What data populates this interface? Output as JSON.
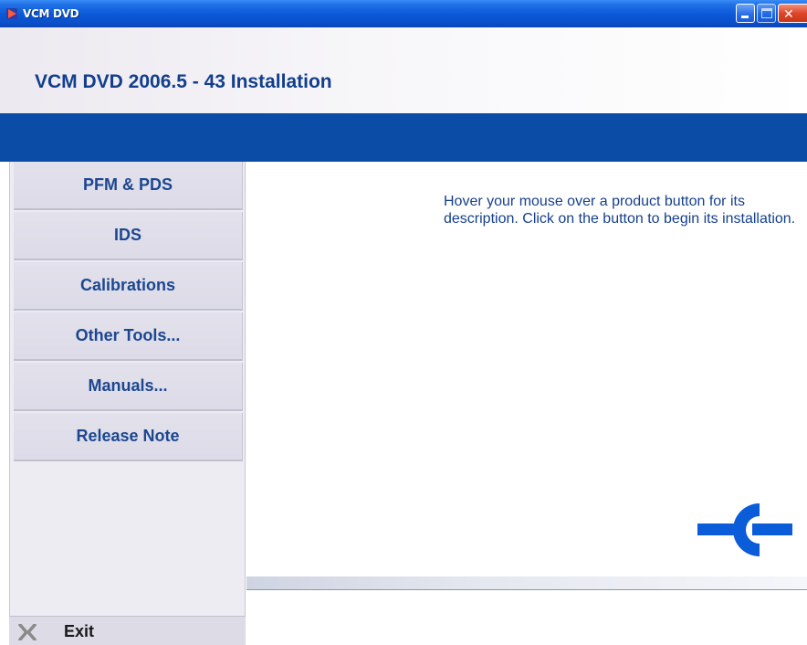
{
  "window": {
    "title": "VCM DVD",
    "icon": "play-arrow-icon",
    "controls": [
      "minimize-icon",
      "maximize-icon",
      "close-icon"
    ]
  },
  "header": {
    "title": "VCM DVD 2006.5 - 43 Installation"
  },
  "sidebar": {
    "items": [
      {
        "label": "PFM & PDS"
      },
      {
        "label": "IDS"
      },
      {
        "label": "Calibrations"
      },
      {
        "label": "Other Tools..."
      },
      {
        "label": "Manuals..."
      },
      {
        "label": "Release Note"
      }
    ],
    "exit": {
      "label": "Exit",
      "icon": "x-icon"
    }
  },
  "main": {
    "description": "Hover your mouse over a product button for its description.  Click on the button to begin its installation.",
    "logo": "brand-logo-icon"
  },
  "colors": {
    "title_bar": "#0a58d6",
    "header_text": "#123e8c",
    "blue_band": "#0a4ca6",
    "nav_text": "#1c4790",
    "description_text": "#16408c",
    "logo": "#0a5cd8"
  }
}
